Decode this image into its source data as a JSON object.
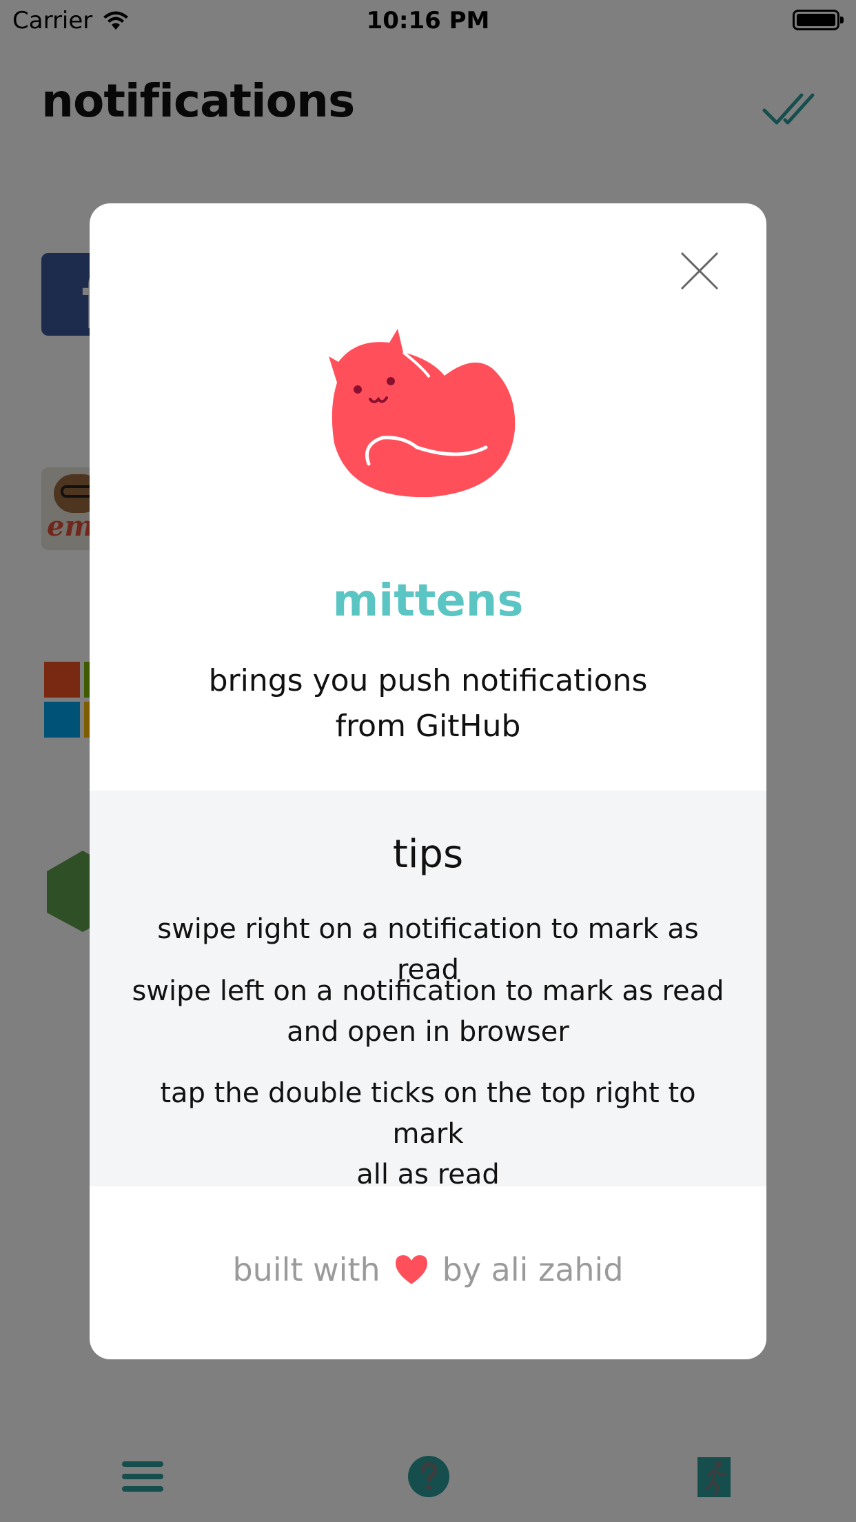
{
  "status_bar": {
    "carrier": "Carrier",
    "time": "10:16 PM"
  },
  "header": {
    "title": "notifications",
    "mark_all_icon": "double-check-icon"
  },
  "list": {
    "items": [
      {
        "icon": "facebook-logo",
        "glyph": "f"
      },
      {
        "icon": "ember-logo",
        "glyph": "emb"
      },
      {
        "icon": "microsoft-logo"
      },
      {
        "icon": "nodejs-logo"
      }
    ]
  },
  "modal": {
    "app_name": "mittens",
    "tagline_line1": "brings you push notifications",
    "tagline_line2": "from GitHub",
    "tips_title": "tips",
    "tips": [
      {
        "line1": "swipe right on a notification to mark as read",
        "line2": ""
      },
      {
        "line1": "swipe left on a notification to mark as read",
        "line2": "and open in browser"
      },
      {
        "line1": "tap the double ticks on the top right to mark",
        "line2": "all as read"
      }
    ],
    "footer_before": "built with",
    "footer_after": "by ali zahid"
  },
  "tab_bar": {
    "items": [
      "menu-icon",
      "help-icon",
      "logout-icon"
    ]
  },
  "colors": {
    "accent": "#2a9d9b",
    "brand": "#5ac5c3",
    "cat": "#ff4f5a",
    "tips_bg": "#f4f5f7"
  }
}
